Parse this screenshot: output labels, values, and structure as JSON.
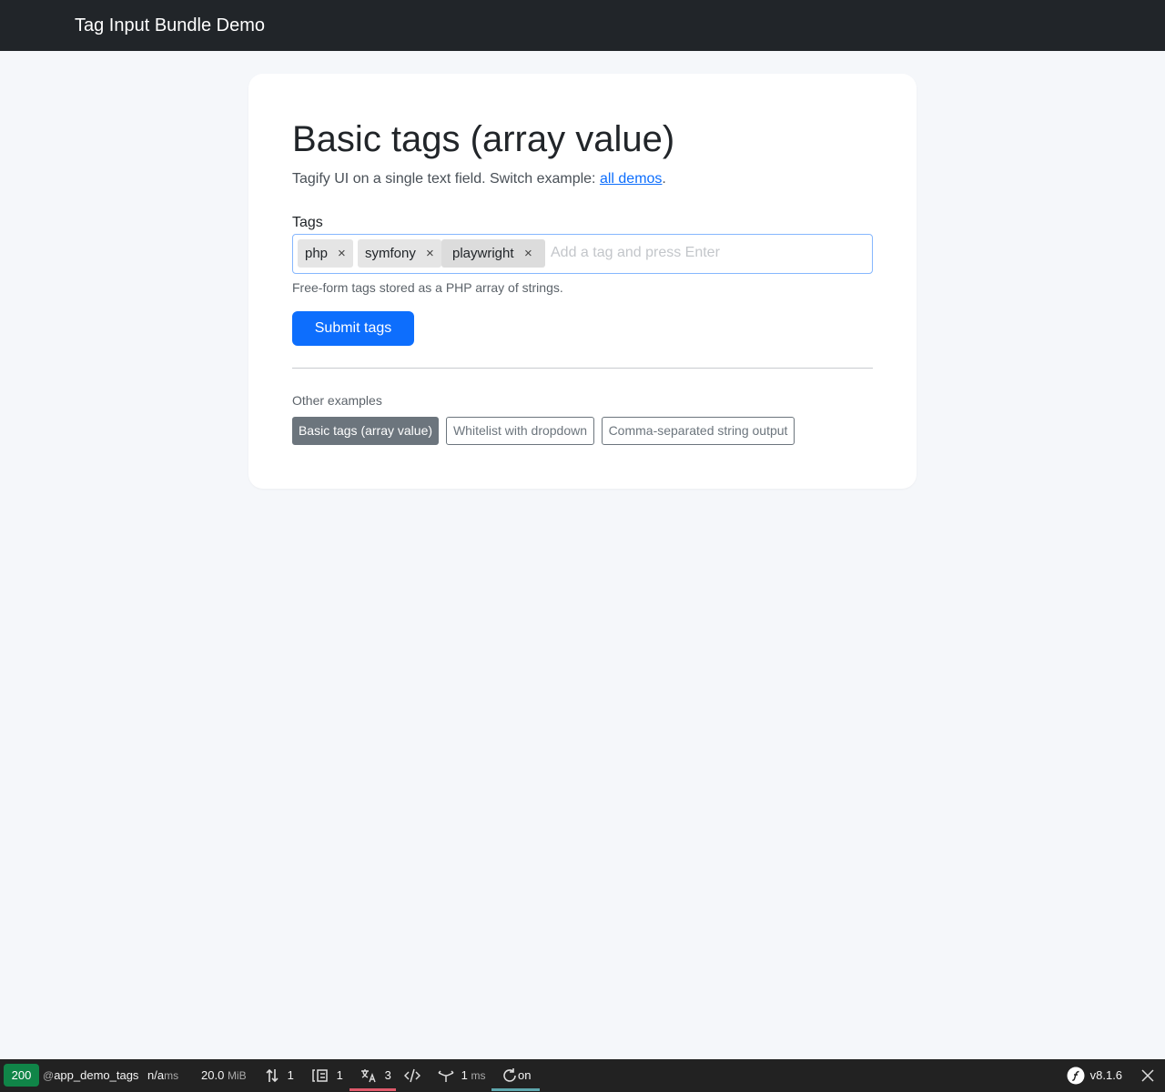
{
  "navbar": {
    "brand": "Tag Input Bundle Demo"
  },
  "main": {
    "title": "Basic tags (array value)",
    "lead_prefix": "Tagify UI on a single text field. Switch example: ",
    "lead_link": "all demos",
    "lead_suffix": ".",
    "field_label": "Tags",
    "tags": [
      "php",
      "symfony",
      "playwright"
    ],
    "remove_glyph": "×",
    "input_placeholder": "Add a tag and press Enter",
    "help_text": "Free-form tags stored as a PHP array of strings.",
    "submit_label": "Submit tags",
    "other_examples_title": "Other examples",
    "examples": [
      "Basic tags (array value)",
      "Whitelist with dropdown",
      "Comma-separated string output"
    ]
  },
  "debug_toolbar": {
    "status_code": "200",
    "route_prefix": "@",
    "route": "app_demo_tags",
    "time_value": "n/a",
    "time_unit": "ms",
    "memory_value": "20.0",
    "memory_unit": "MiB",
    "requests_count": "1",
    "forms_count": "1",
    "translation_count": "3",
    "workflow_value": "1",
    "workflow_unit": "ms",
    "live_reload": "on",
    "version": "v8.1.6"
  },
  "colors": {
    "navbar_bg": "#212529",
    "primary": "#0d6efd",
    "secondary": "#6c757d",
    "status_ok": "#108548"
  }
}
